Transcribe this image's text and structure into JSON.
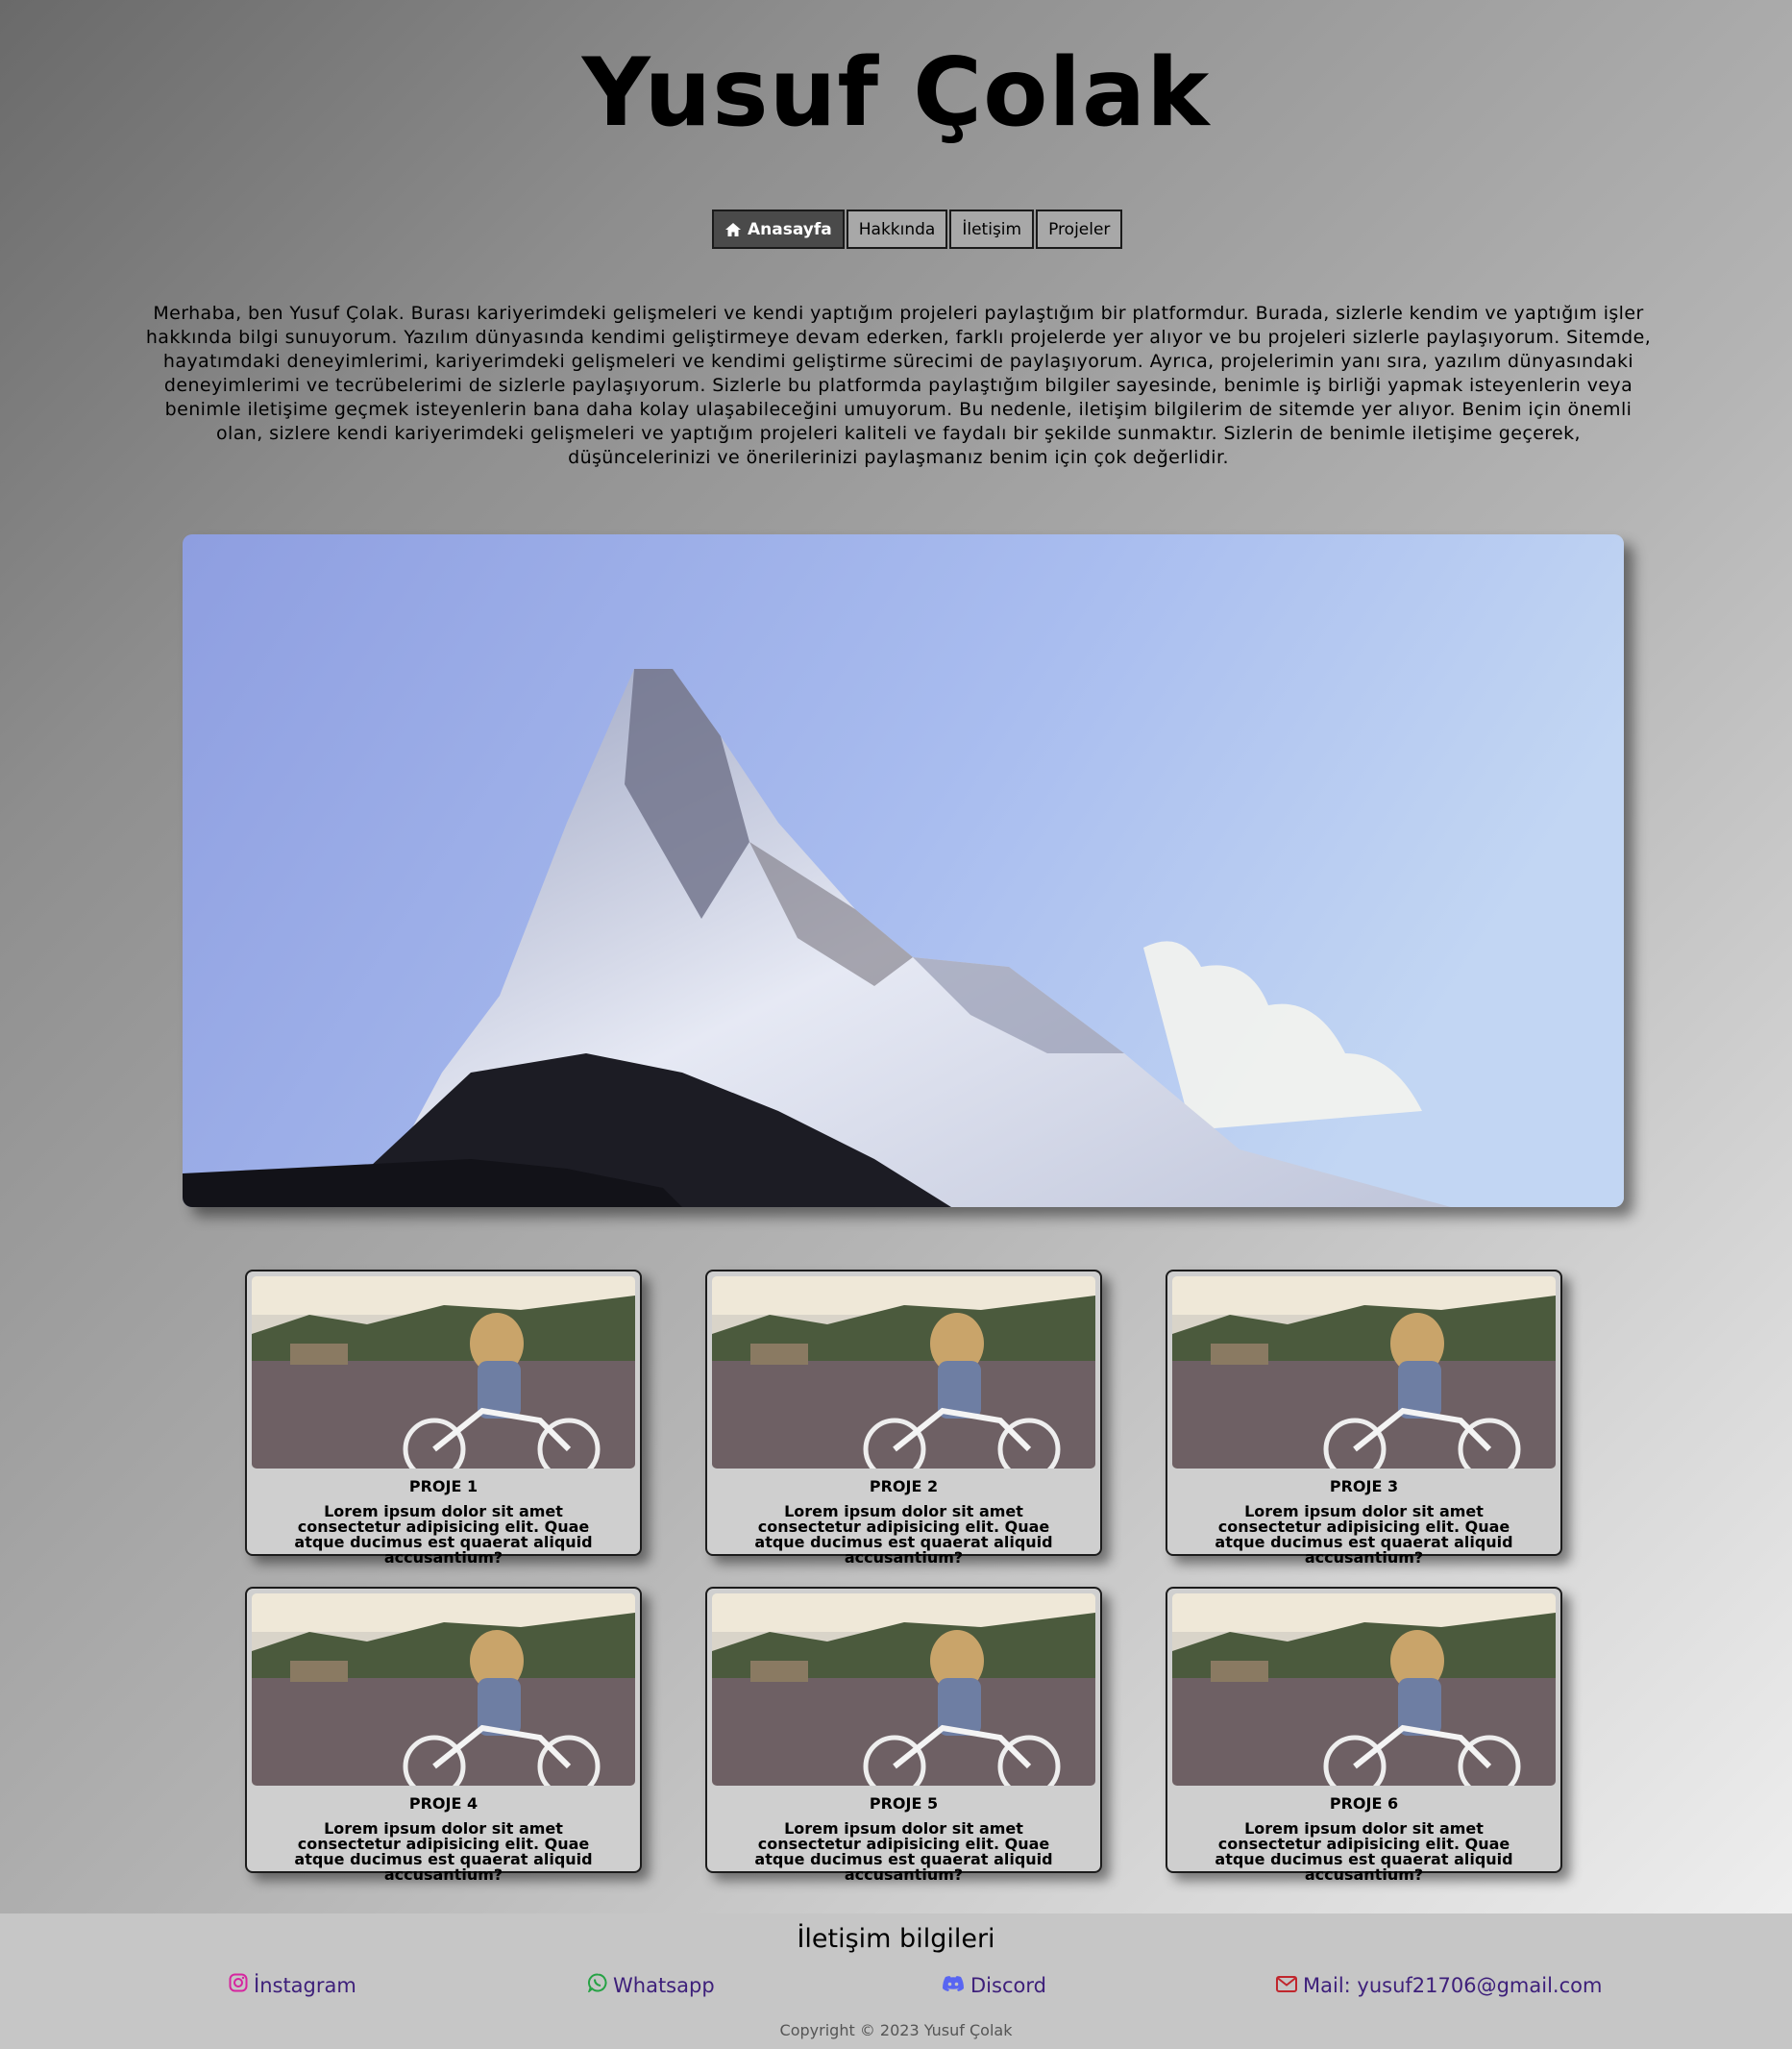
{
  "header": {
    "title": "Yusuf Çolak"
  },
  "nav": {
    "items": [
      {
        "label": "Anasayfa",
        "icon": "home-icon",
        "active": true
      },
      {
        "label": "Hakkında"
      },
      {
        "label": "İletişim"
      },
      {
        "label": "Projeler"
      }
    ]
  },
  "intro": {
    "text": "Merhaba, ben Yusuf Çolak. Burası kariyerimdeki gelişmeleri ve kendi yaptığım projeleri paylaştığım bir platformdur. Burada, sizlerle kendim ve yaptığım işler hakkında bilgi sunuyorum. Yazılım dünyasında kendimi geliştirmeye devam ederken, farklı projelerde yer alıyor ve bu projeleri sizlerle paylaşıyorum. Sitemde, hayatımdaki deneyimlerimi, kariyerimdeki gelişmeleri ve kendimi geliştirme sürecimi de paylaşıyorum. Ayrıca, projelerimin yanı sıra, yazılım dünyasındaki deneyimlerimi ve tecrübelerimi de sizlerle paylaşıyorum. Sizlerle bu platformda paylaştığım bilgiler sayesinde, benimle iş birliği yapmak isteyenlerin veya benimle iletişime geçmek isteyenlerin bana daha kolay ulaşabileceğini umuyorum. Bu nedenle, iletişim bilgilerim de sitemde yer alıyor. Benim için önemli olan, sizlere kendi kariyerimdeki gelişmeleri ve yaptığım projeleri kaliteli ve faydalı bir şekilde sunmaktır. Sizlerin de benimle iletişime geçerek, düşüncelerinizi ve önerilerinizi paylaşmanız benim için çok değerlidir."
  },
  "projects": [
    {
      "title": "PROJE 1",
      "desc": "Lorem ipsum dolor sit amet consectetur adipisicing elit. Quae atque ducimus est quaerat aliquid accusantium?"
    },
    {
      "title": "PROJE 2",
      "desc": "Lorem ipsum dolor sit amet consectetur adipisicing elit. Quae atque ducimus est quaerat aliquid accusantium?"
    },
    {
      "title": "PROJE 3",
      "desc": "Lorem ipsum dolor sit amet consectetur adipisicing elit. Quae atque ducimus est quaerat aliquid accusantium?"
    },
    {
      "title": "PROJE 4",
      "desc": "Lorem ipsum dolor sit amet consectetur adipisicing elit. Quae atque ducimus est quaerat aliquid accusantium?"
    },
    {
      "title": "PROJE 5",
      "desc": "Lorem ipsum dolor sit amet consectetur adipisicing elit. Quae atque ducimus est quaerat aliquid accusantium?"
    },
    {
      "title": "PROJE 6",
      "desc": "Lorem ipsum dolor sit amet consectetur adipisicing elit. Quae atque ducimus est quaerat aliquid accusantium?"
    }
  ],
  "footer": {
    "title": "İletişim bilgileri",
    "links": [
      {
        "label": "İnstagram",
        "icon": "instagram-icon",
        "color": "#d6249f"
      },
      {
        "label": "Whatsapp",
        "icon": "whatsapp-icon",
        "color": "#25a244"
      },
      {
        "label": "Discord",
        "icon": "discord-icon",
        "color": "#5865f2"
      },
      {
        "label": "Mail: yusuf21706@gmail.com",
        "icon": "envelope-icon",
        "color": "#c0262d"
      }
    ],
    "copyright": "Copyright © 2023 Yusuf Çolak"
  },
  "colors": {
    "link_text": "#3d1f7a",
    "active_nav": "#4a4a4a"
  }
}
